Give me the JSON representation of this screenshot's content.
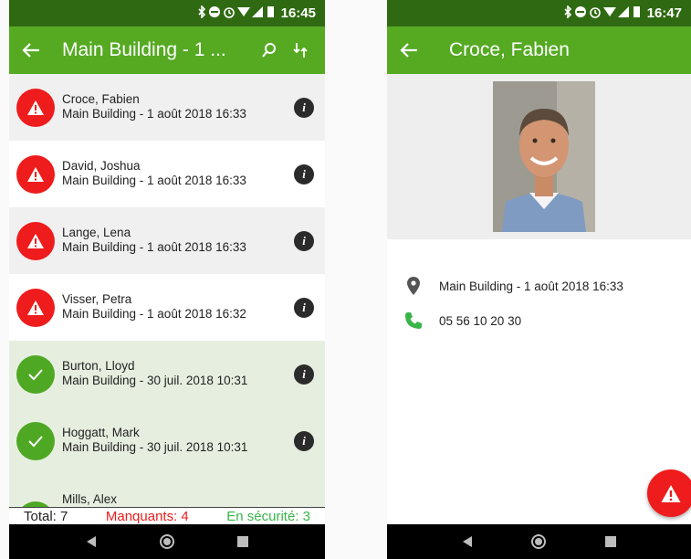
{
  "left_screen": {
    "status_bar": {
      "time": "16:45",
      "icons": [
        "bluetooth-icon",
        "do-not-disturb-icon",
        "alarm-icon",
        "wifi-icon",
        "signal-icon",
        "battery-icon"
      ]
    },
    "app_bar": {
      "title": "Main Building - 1 ...",
      "actions": [
        "search-icon",
        "sort-icon"
      ]
    },
    "rows": [
      {
        "name": "Croce, Fabien",
        "detail": "Main Building - 1 août 2018 16:33",
        "status": "missing"
      },
      {
        "name": "David, Joshua",
        "detail": "Main Building - 1 août 2018 16:33",
        "status": "missing"
      },
      {
        "name": "Lange, Lena",
        "detail": "Main Building - 1 août 2018 16:33",
        "status": "missing"
      },
      {
        "name": "Visser, Petra",
        "detail": "Main Building - 1 août 2018 16:32",
        "status": "missing"
      },
      {
        "name": "Burton, Lloyd",
        "detail": "Main Building - 30 juil. 2018 10:31",
        "status": "safe"
      },
      {
        "name": "Hoggatt, Mark",
        "detail": "Main Building - 30 juil. 2018 10:31",
        "status": "safe"
      },
      {
        "name": "Mills, Alex",
        "detail": "",
        "status": "safe"
      }
    ],
    "info_glyph": "i",
    "totals": {
      "total": "Total: 7",
      "missing": "Manquants: 4",
      "safe": "En sécurité: 3"
    }
  },
  "right_screen": {
    "status_bar": {
      "time": "16:47"
    },
    "app_bar": {
      "title": "Croce, Fabien"
    },
    "location": "Main Building - 1 août 2018 16:33",
    "phone": "05 56 10 20 30"
  },
  "colors": {
    "appbar": "#55aa22",
    "statusbar": "#2f6a12",
    "missing": "#ee1c1c",
    "safe": "#4fa823",
    "safe_row": "#e6efdf",
    "safe_text": "#39b54a"
  }
}
